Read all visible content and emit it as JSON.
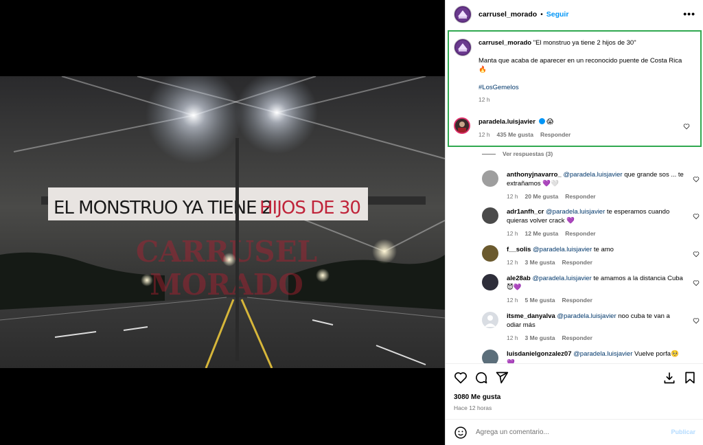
{
  "post": {
    "username": "carrusel_morado",
    "separator": "•",
    "follow_label": "Seguir",
    "more_label": "•••",
    "banner_text_black": "EL MONSTRUO YA TIENE 2",
    "banner_text_red": "HIJOS DE 30",
    "watermark_line1": "CARRUSEL",
    "watermark_line2": "MORADO"
  },
  "caption": {
    "username": "carrusel_morado",
    "title": "\"El monstruo ya tiene 2 hijos de 30\"",
    "body": "Manta que acaba de aparecer en un reconocido puente de Costa Rica 🔥",
    "hashtag": "#LosGemelos",
    "time": "12 h"
  },
  "pinned_comment": {
    "username": "paradela.luisjavier",
    "badge": "😱",
    "time": "12 h",
    "likes": "435 Me gusta",
    "reply": "Responder",
    "view_replies": "Ver respuestas (3)"
  },
  "replies": [
    {
      "username": "anthonyjnavarro_",
      "mention": "@paradela.luisjavier",
      "text": " que grande sos ... te extrañamos 💜🤍",
      "time": "12 h",
      "likes": "20 Me gusta",
      "reply": "Responder"
    },
    {
      "username": "adr1anfh_cr",
      "mention": "@paradela.luisjavier",
      "text": " te esperamos cuando quieras volver crack 💜",
      "time": "12 h",
      "likes": "12 Me gusta",
      "reply": "Responder"
    },
    {
      "username": "f__solis",
      "mention": "@paradela.luisjavier",
      "text": " te amo",
      "time": "12 h",
      "likes": "3 Me gusta",
      "reply": "Responder"
    },
    {
      "username": "ale28ab",
      "mention": "@paradela.luisjavier",
      "text": " te amamos a la distancia Cuba 😈💜",
      "time": "12 h",
      "likes": "5 Me gusta",
      "reply": "Responder"
    },
    {
      "username": "itsme_danyalva",
      "mention": "@paradela.luisjavier",
      "text": " noo cuba te van a odiar más",
      "time": "12 h",
      "likes": "3 Me gusta",
      "reply": "Responder"
    },
    {
      "username": "luisdanielgonzalez07",
      "mention": "@paradela.luisjavier",
      "text": " Vuelve porfa🥺💜",
      "time": "",
      "likes": "",
      "reply": ""
    }
  ],
  "footer": {
    "likes": "3080 Me gusta",
    "ago": "Hace 12 horas",
    "comment_placeholder": "Agrega un comentario...",
    "publish_label": "Publicar"
  },
  "colors": {
    "accent_blue": "#0095f6",
    "highlight_green": "#2fa84f",
    "brand_purple": "#5a2d7a",
    "banner_red": "#c0243a"
  }
}
